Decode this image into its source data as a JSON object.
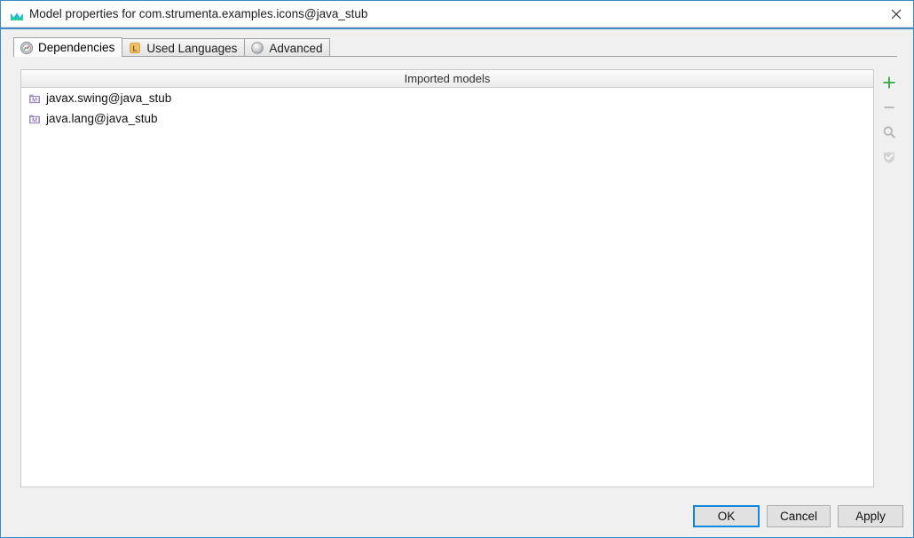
{
  "window": {
    "title": "Model properties for com.strumenta.examples.icons@java_stub",
    "title_icon": "mps-logo-icon",
    "close_icon": "close-icon",
    "accent_color": "#3d8ac4",
    "focus_color": "#0f87dc"
  },
  "tabs": [
    {
      "label": "Dependencies",
      "icon": "dependencies-icon",
      "selected": true
    },
    {
      "label": "Used Languages",
      "icon": "used-languages-icon",
      "selected": false
    },
    {
      "label": "Advanced",
      "icon": "advanced-icon",
      "selected": false
    }
  ],
  "imported_models": {
    "header": "Imported models",
    "rows": [
      {
        "label": "javax.swing@java_stub",
        "icon": "model-icon"
      },
      {
        "label": "java.lang@java_stub",
        "icon": "model-icon"
      }
    ]
  },
  "side_toolbar": [
    {
      "name": "add-button",
      "icon": "plus-icon",
      "enabled": true,
      "color": "#3fad54"
    },
    {
      "name": "remove-button",
      "icon": "minus-icon",
      "enabled": false,
      "color": "#b8b8b8"
    },
    {
      "name": "find-button",
      "icon": "magnifier-icon",
      "enabled": false,
      "color": "#b8b8b8"
    },
    {
      "name": "validate-button",
      "icon": "shield-check-icon",
      "enabled": false,
      "color": "#cfcfcf"
    }
  ],
  "buttons": {
    "ok": "OK",
    "cancel": "Cancel",
    "apply": "Apply"
  }
}
